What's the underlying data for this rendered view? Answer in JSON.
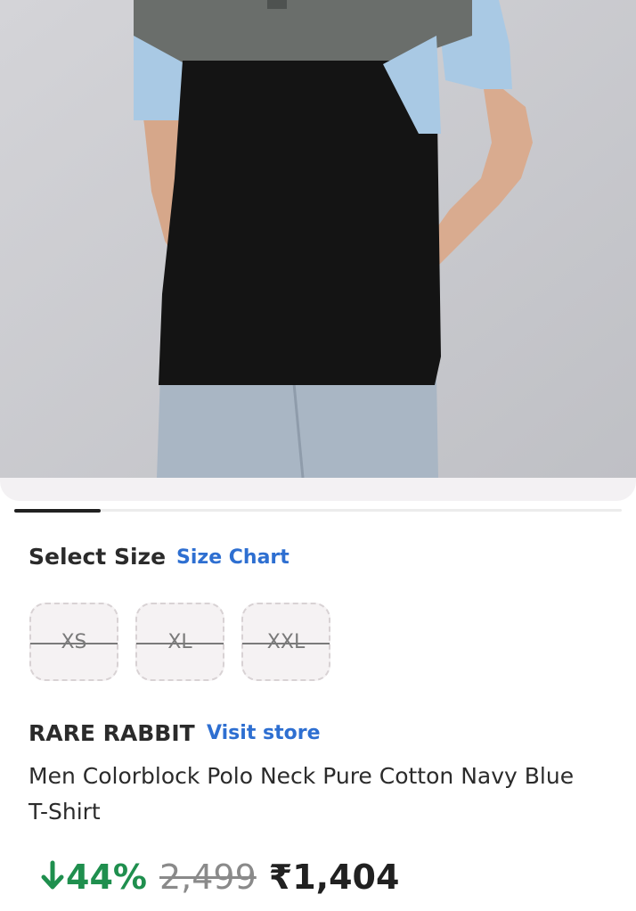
{
  "product_image": {
    "description": "model-wearing-colorblock-polo",
    "palette": {
      "grey": "#6a6e6b",
      "black": "#141414",
      "sky_blue": "#a9c9e4",
      "backdrop": "#c9cace",
      "trousers": "#a9b6c4",
      "skin": "#d9ab8f"
    }
  },
  "carousel": {
    "active_index": 1,
    "progress": 0.14
  },
  "size_section": {
    "title": "Select Size",
    "chart_link": "Size Chart",
    "options": [
      {
        "label": "XS",
        "available": false
      },
      {
        "label": "XL",
        "available": false
      },
      {
        "label": "XXL",
        "available": false
      }
    ]
  },
  "brand": {
    "name": "RARE RABBIT",
    "visit_label": "Visit store"
  },
  "product": {
    "name": "Men Colorblock Polo Neck Pure Cotton Navy Blue T-Shirt"
  },
  "pricing": {
    "discount": "44%",
    "mrp": "2,499",
    "price": "₹1,404",
    "discount_color": "#1f8f4e"
  },
  "colors": {
    "link": "#2e6fd1",
    "text": "#2b2b2b"
  }
}
